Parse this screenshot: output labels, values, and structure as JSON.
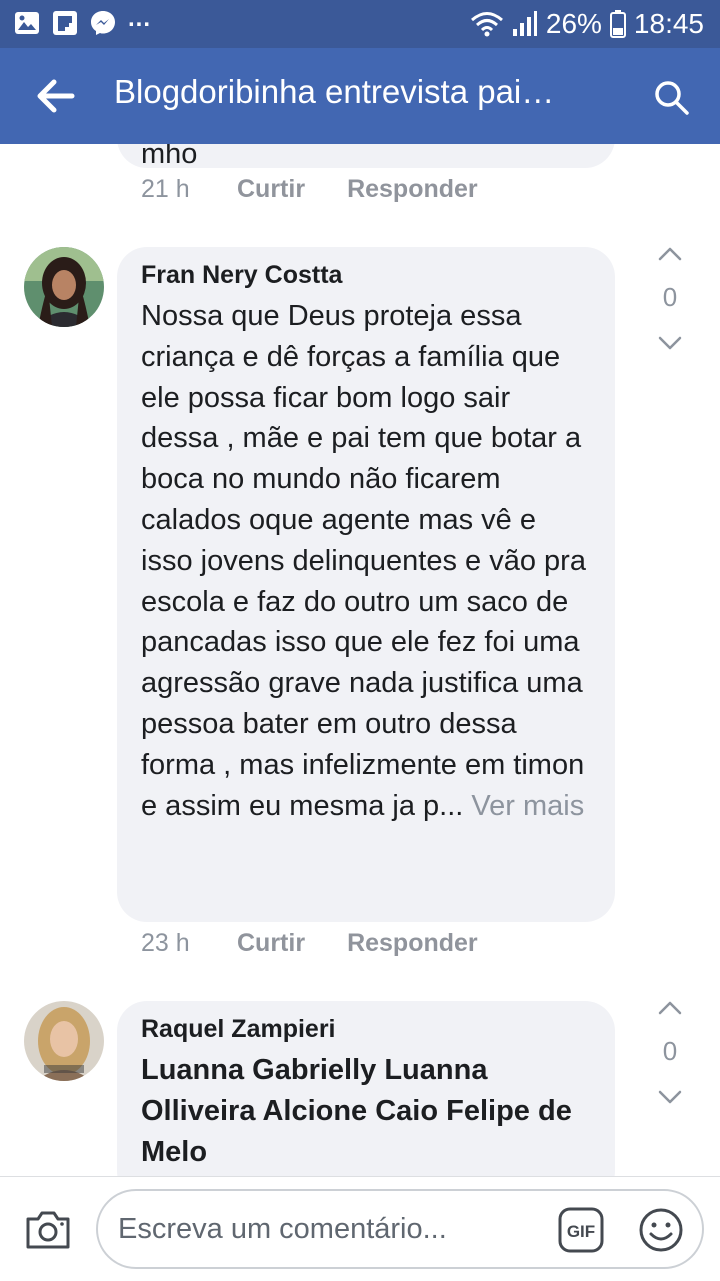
{
  "status_bar": {
    "battery": "26%",
    "time": "18:45",
    "overflow": "..."
  },
  "app_bar": {
    "title": "Blogdoribinha entrevista pai…"
  },
  "comments": [
    {
      "partial_text": "mho",
      "time": "21 h",
      "like": "Curtir",
      "reply": "Responder"
    },
    {
      "author": "Fran Nery Costta",
      "text": "Nossa que Deus proteja essa criança e dê forças a família que ele possa ficar bom logo sair dessa , mãe e pai tem que botar a boca no mundo não ficarem calados oque agente mas vê e isso jovens delinquentes e vão pra escola e faz do outro um saco de pancadas isso que ele fez foi uma agressão grave nada justifica uma pessoa bater em outro dessa forma , mas infelizmente em timon e assim eu mesma ja p...",
      "see_more": "Ver mais",
      "time": "23 h",
      "like": "Curtir",
      "reply": "Responder",
      "votes": "0"
    },
    {
      "author": "Raquel Zampieri",
      "text": "Luanna Gabrielly Luanna Olliveira Alcione Caio Felipe de Melo",
      "votes": "0"
    }
  ],
  "composer": {
    "placeholder": "Escreva um comentário...",
    "gif_label": "GIF"
  },
  "colors": {
    "status_bar": "#3b5998",
    "app_bar": "#4267b2",
    "bubble": "#f1f2f6",
    "meta_text": "#8d949e"
  }
}
